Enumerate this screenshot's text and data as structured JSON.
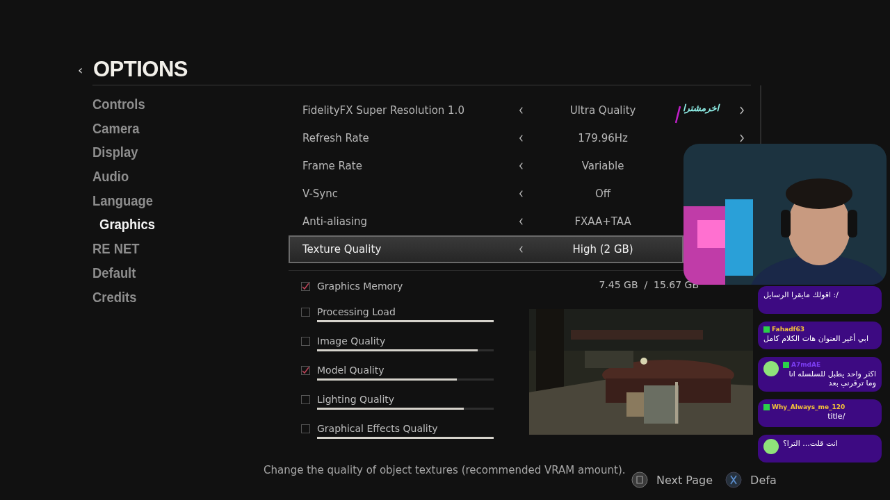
{
  "header": {
    "back": "‹",
    "title": "OPTIONS"
  },
  "sidebar": {
    "items": [
      {
        "label": "Controls",
        "selected": false
      },
      {
        "label": "Camera",
        "selected": false
      },
      {
        "label": "Display",
        "selected": false
      },
      {
        "label": "Audio",
        "selected": false
      },
      {
        "label": "Language",
        "selected": false
      },
      {
        "label": "Graphics",
        "selected": true
      },
      {
        "label": "RE NET",
        "selected": false
      },
      {
        "label": "Default",
        "selected": false
      },
      {
        "label": "Credits",
        "selected": false
      }
    ]
  },
  "settings": [
    {
      "label": "FidelityFX Super Resolution 1.0",
      "value": "Ultra Quality",
      "selected": false,
      "has_next": true
    },
    {
      "label": "Refresh Rate",
      "value": "179.96Hz",
      "selected": false,
      "has_next": true
    },
    {
      "label": "Frame Rate",
      "value": "Variable",
      "selected": false,
      "has_next": false
    },
    {
      "label": "V-Sync",
      "value": "Off",
      "selected": false,
      "has_next": false
    },
    {
      "label": "Anti-aliasing",
      "value": "FXAA+TAA",
      "selected": false,
      "has_next": false
    },
    {
      "label": "Texture Quality",
      "value": "High (2 GB)",
      "selected": true,
      "has_next": false
    }
  ],
  "memory": {
    "label": "Graphics Memory",
    "checked": true,
    "used": "7.45 GB",
    "separator": "/",
    "total": "15.67 GB"
  },
  "meters": [
    {
      "label": "Processing Load",
      "checked": false,
      "level": 1.0
    },
    {
      "label": "Image Quality",
      "checked": false,
      "level": 0.91
    },
    {
      "label": "Model Quality",
      "checked": true,
      "level": 0.79
    },
    {
      "label": "Lighting Quality",
      "checked": false,
      "level": 0.83
    },
    {
      "label": "Graphical Effects Quality",
      "checked": false,
      "level": 1.0
    }
  ],
  "hint": "Change the quality of object textures (recommended VRAM amount).",
  "footer": [
    {
      "label": "Next Page"
    },
    {
      "label": "Defa"
    }
  ],
  "overlay": {
    "subscriber": "اخرمشترا",
    "chat": [
      {
        "text": "/: اقولك مايقرا الرسايل",
        "avatar": false
      },
      {
        "user": "Fahadf63",
        "color": "#f3c13a",
        "text": "ابي أغير العنوان هات الكلام كامل",
        "avatar": false
      },
      {
        "user": "A7mdAE",
        "color": "#7a3cf0",
        "text": "اكثر واحد يطبل للسلسله انا وما ترقرني بعد",
        "avatar": true
      },
      {
        "user": "Why_Always_me_120",
        "color": "#f3c13a",
        "text": "/title",
        "avatar": false
      },
      {
        "text": "انت قلت... الترا؟",
        "avatar": true
      }
    ]
  }
}
